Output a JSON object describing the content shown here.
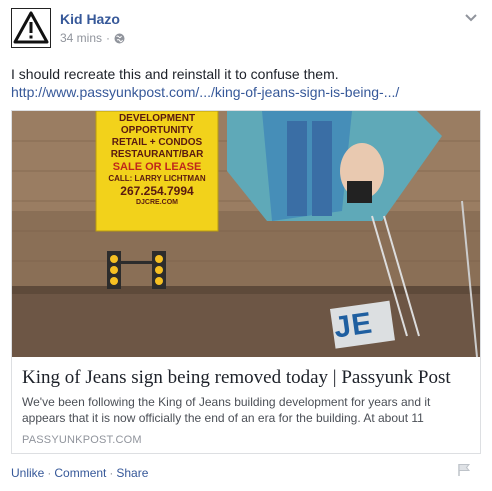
{
  "post": {
    "author": "Kid Hazo",
    "time": "34 mins",
    "separator": "·",
    "text": "I should recreate this and reinstall it to confuse them.",
    "link": "http://www.passyunkpost.com/.../king-of-jeans-sign-is-being-.../"
  },
  "card": {
    "title": "King of Jeans sign being removed today | Passyunk Post",
    "description": "We've been following the King of Jeans building development for years and it appears that it is now officially the end of an era for the building. At about 11",
    "domain": "PASSYUNKPOST.COM",
    "image": {
      "sign_lines": [
        "DEVELOPMENT",
        "OPPORTUNITY",
        "RETAIL + CONDOS",
        "RESTAURANT/BAR",
        "SALE OR LEASE",
        "CALL: LARRY LICHTMAN",
        "267.254.7994",
        "DJCRE.COM"
      ],
      "letters": "JE"
    }
  },
  "actions": {
    "unlike": "Unlike",
    "comment": "Comment",
    "share": "Share",
    "separator": "·"
  },
  "icons": {
    "avatar": "warning-triangle-icon",
    "menu": "chevron-down-icon",
    "privacy": "globe-icon",
    "report": "flag-icon"
  }
}
